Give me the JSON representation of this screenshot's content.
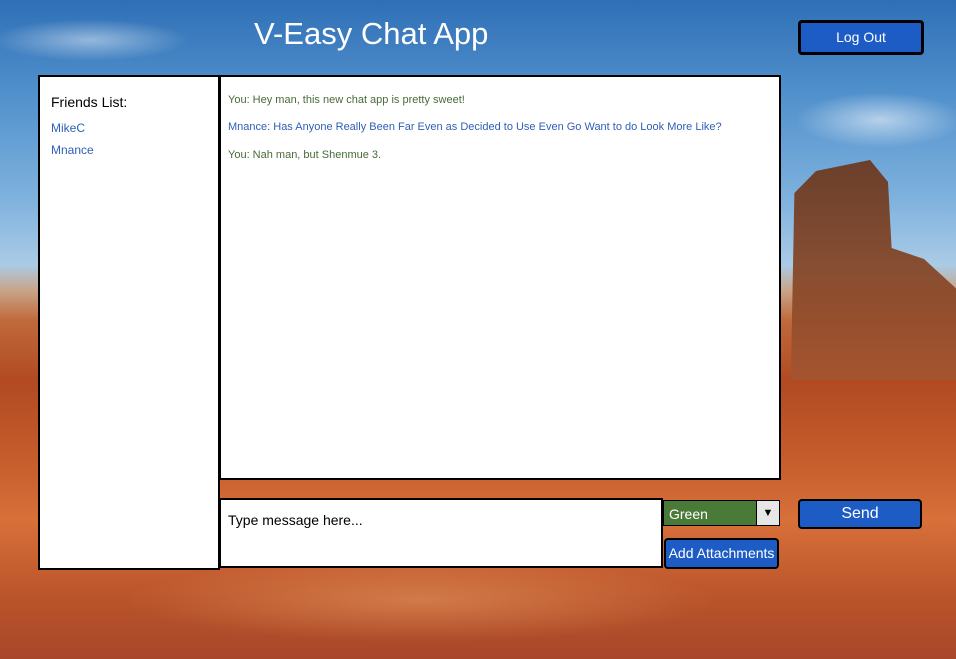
{
  "app": {
    "title": "V-Easy Chat App",
    "logout_label": "Log Out"
  },
  "friends": {
    "heading": "Friends List:",
    "items": [
      {
        "name": "MikeC"
      },
      {
        "name": "Mnance"
      }
    ]
  },
  "chat": {
    "messages": [
      {
        "text": "You: Hey man, this new chat app is pretty sweet!",
        "sender": "you"
      },
      {
        "text": "Mnance: Has Anyone Really Been Far Even as Decided to Use Even Go Want to do Look More Like?",
        "sender": "friend"
      },
      {
        "text": "You: Nah man, but Shenmue 3.",
        "sender": "you"
      }
    ]
  },
  "composer": {
    "placeholder": "Type message here...",
    "value": "",
    "color_selected": "Green",
    "attach_label": "Add Attachments",
    "send_label": "Send"
  },
  "colors": {
    "button_blue": "#1d5cc4",
    "green_select": "#4a7a38",
    "you_text": "#4a6a3a",
    "friend_text": "#2f5fb6"
  },
  "icons": {
    "dropdown": "chevron-down-icon"
  }
}
